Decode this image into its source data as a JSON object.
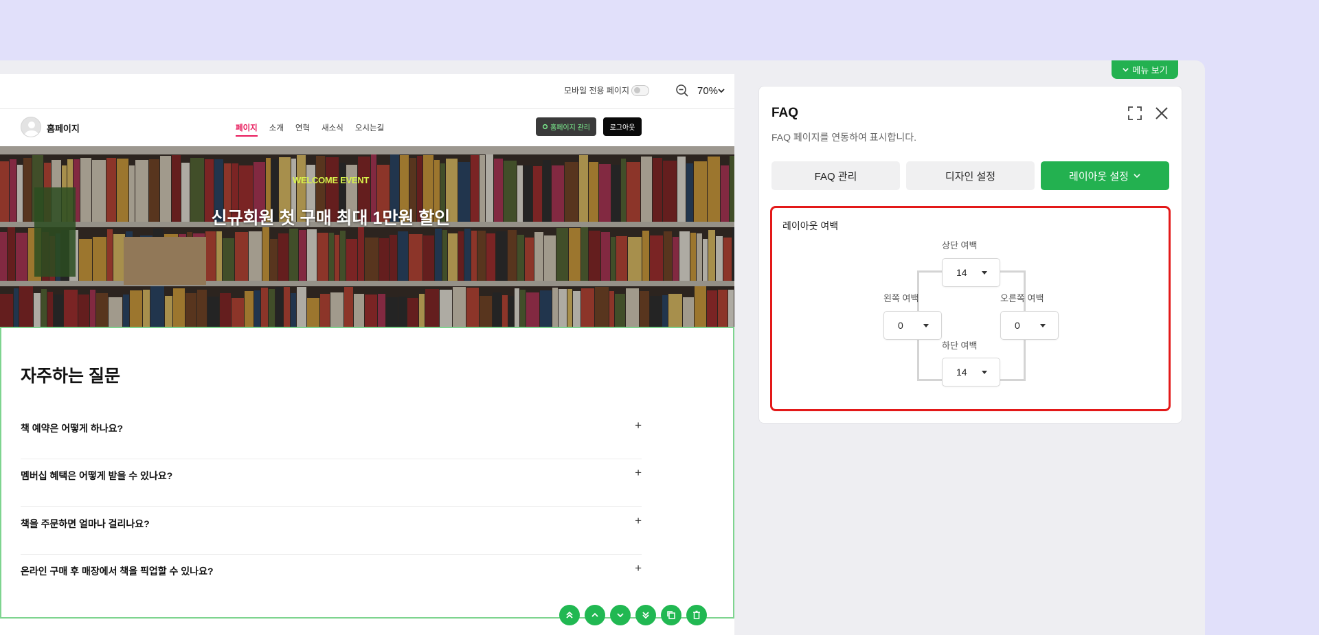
{
  "editor": {
    "mobile_only_label": "모바일 전용 페이지",
    "zoom_value": "70%"
  },
  "site": {
    "name": "홈페이지",
    "nav": [
      "페이지",
      "소개",
      "연혁",
      "새소식",
      "오시는길"
    ],
    "admin_button": "홈페이지 관리",
    "logout_button": "로그아웃"
  },
  "banner": {
    "event_label": "WELCOME EVENT",
    "headline": "신규회원 첫 구매 최대 1만원 할인"
  },
  "faq": {
    "heading": "자주하는 질문",
    "items": [
      "책 예약은 어떻게 하나요?",
      "멤버십 혜택은 어떻게 받을 수 있나요?",
      "책을 주문하면 얼마나 걸리나요?",
      "온라인 구매 후 매장에서 책을 픽업할 수 있나요?"
    ]
  },
  "panel": {
    "menu_toggle": "메뉴 보기",
    "title": "FAQ",
    "description": "FAQ 페이지를 연동하여 표시합니다.",
    "tabs": {
      "faq_manage": "FAQ 관리",
      "design": "디자인 설정",
      "layout": "레이아웃 설정"
    },
    "layout_margin": {
      "title": "레이아웃 여백",
      "top_label": "상단 여백",
      "top_value": "14",
      "left_label": "왼쪽 여백",
      "left_value": "0",
      "right_label": "오른쪽 여백",
      "right_value": "0",
      "bottom_label": "하단 여백",
      "bottom_value": "14"
    }
  },
  "colors": {
    "accent_green": "#23b150",
    "nav_active": "#e8185a",
    "highlight_red": "#e31919",
    "event_yellow": "#d8f24b"
  }
}
